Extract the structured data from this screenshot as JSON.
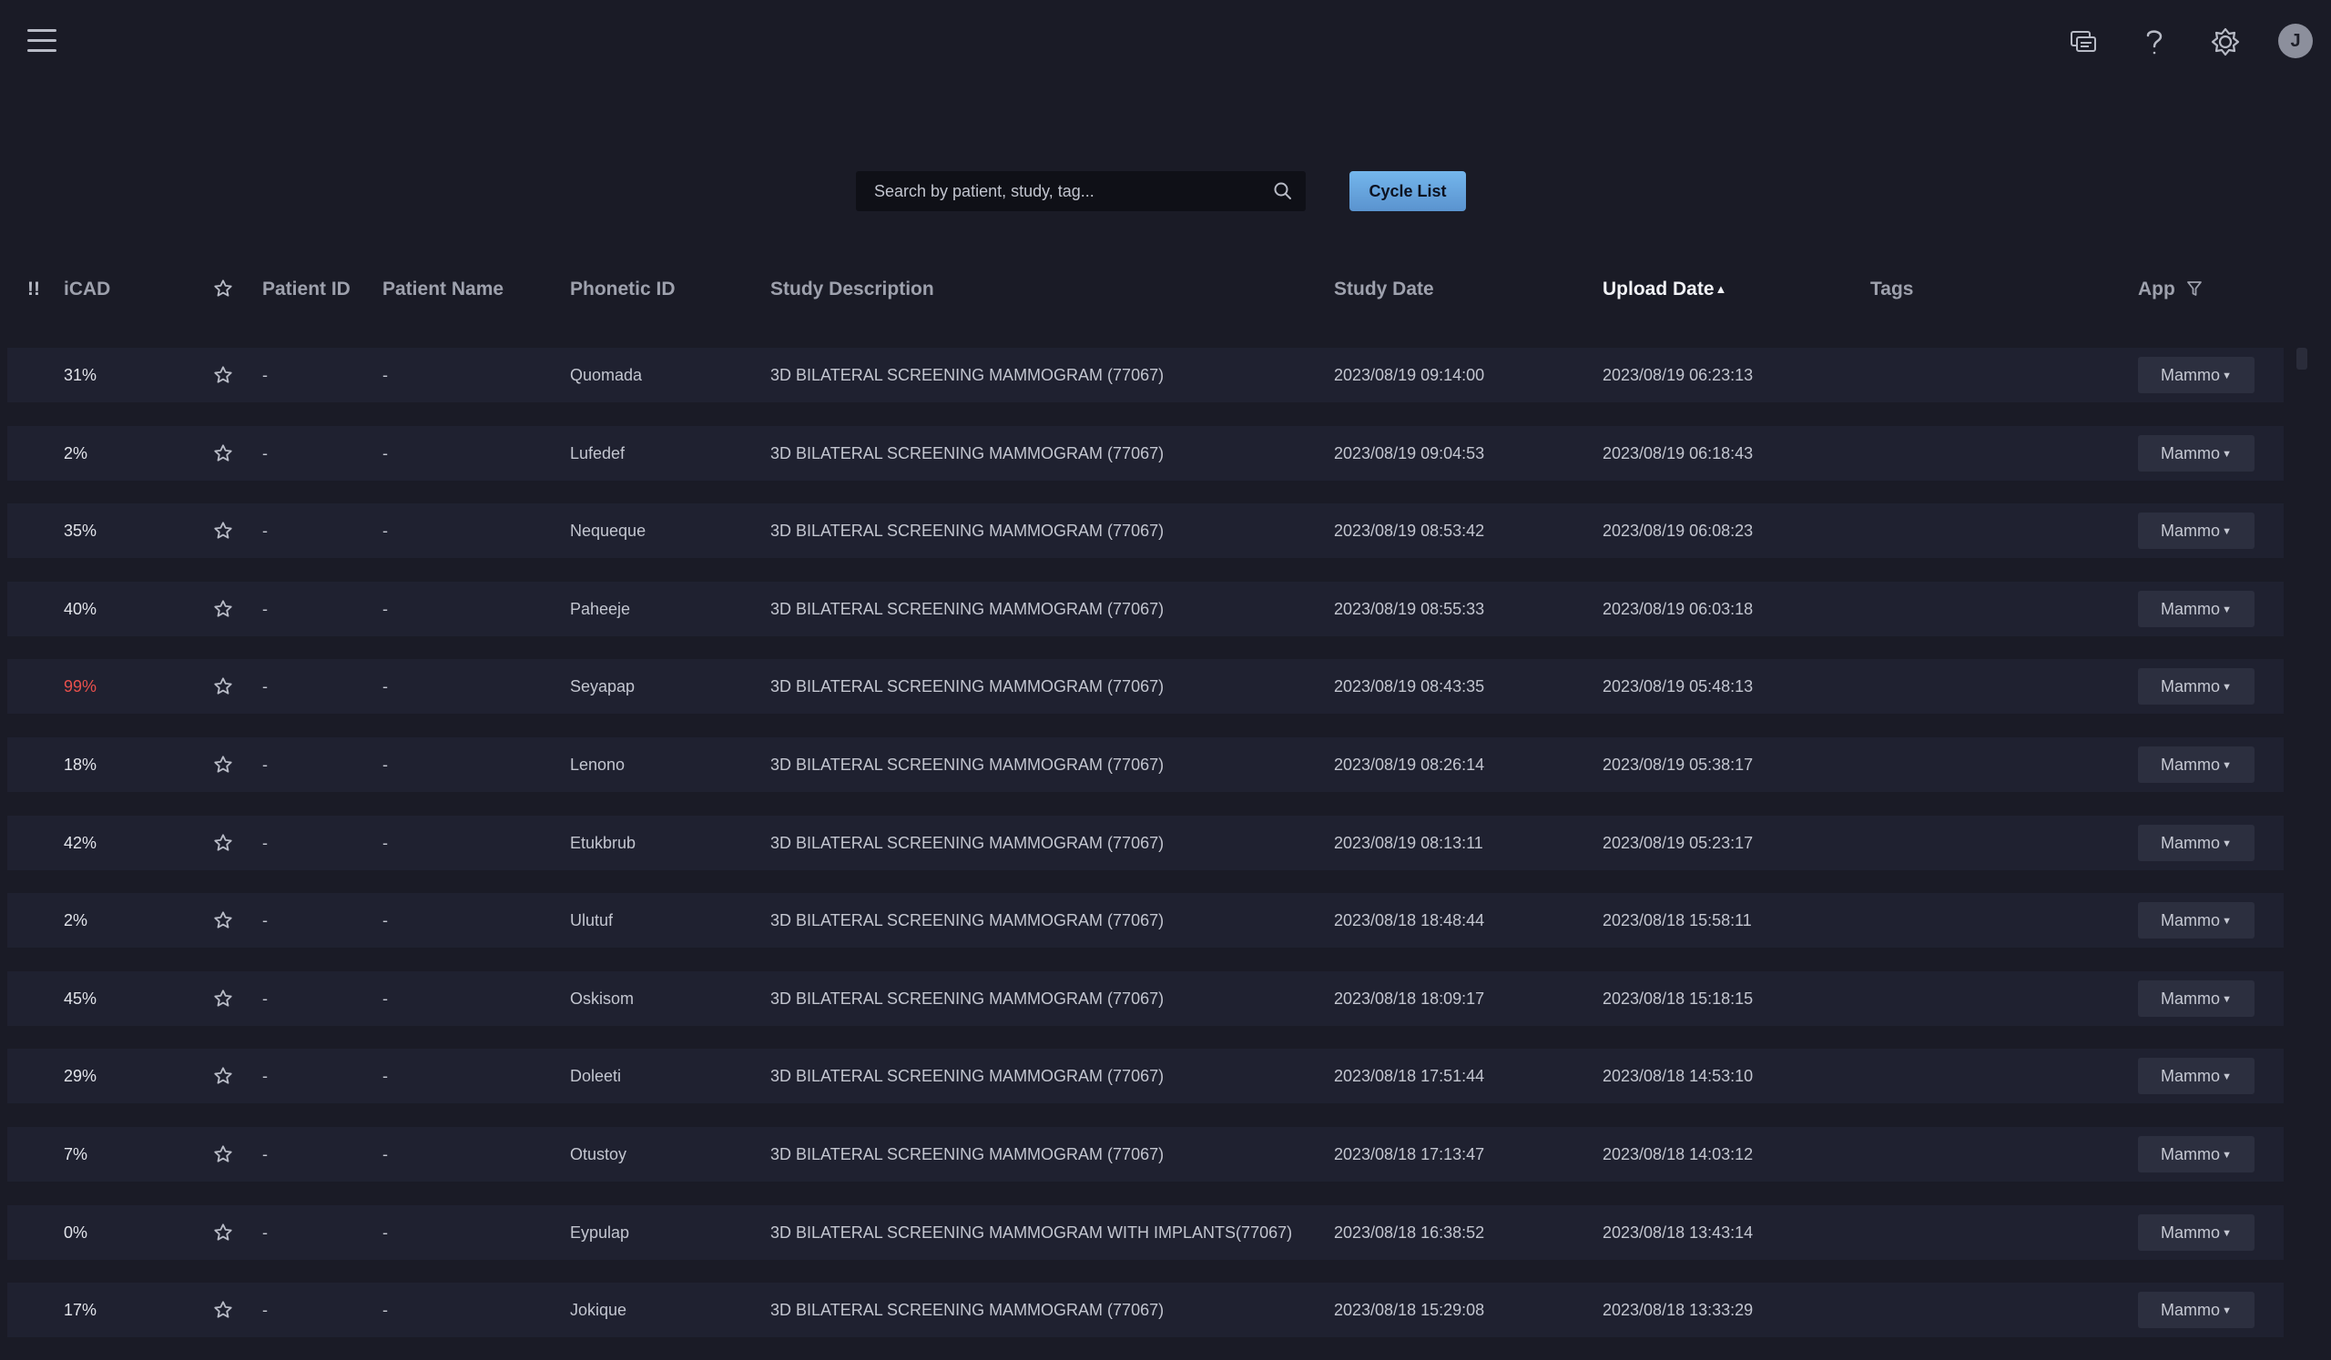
{
  "topbar": {
    "menu_icon": "hamburger-menu-icon",
    "icons": [
      "chat-icon",
      "help-icon",
      "settings-icon"
    ],
    "avatar_initial": "J"
  },
  "search": {
    "placeholder": "Search by patient, study, tag...",
    "icon": "search-icon"
  },
  "cycle_button_label": "Cycle List",
  "table": {
    "headers": {
      "priority": "!!",
      "icad": "iCAD",
      "patient_id": "Patient ID",
      "patient_name": "Patient Name",
      "phonetic_id": "Phonetic ID",
      "study_description": "Study Description",
      "study_date": "Study Date",
      "upload_date": "Upload Date",
      "tags": "Tags",
      "app": "App"
    },
    "sorted_by": "upload_date",
    "sort_direction": "ascending",
    "rows": [
      {
        "icad": "31%",
        "patient_id": "-",
        "patient_name": "-",
        "phonetic_id": "Quomada",
        "study_description": "3D BILATERAL SCREENING MAMMOGRAM (77067)",
        "study_date": "2023/08/19 09:14:00",
        "upload_date": "2023/08/19 06:23:13",
        "tags": "",
        "app": "Mammo",
        "high_risk": false
      },
      {
        "icad": "2%",
        "patient_id": "-",
        "patient_name": "-",
        "phonetic_id": "Lufedef",
        "study_description": "3D BILATERAL SCREENING MAMMOGRAM (77067)",
        "study_date": "2023/08/19 09:04:53",
        "upload_date": "2023/08/19 06:18:43",
        "tags": "",
        "app": "Mammo",
        "high_risk": false
      },
      {
        "icad": "35%",
        "patient_id": "-",
        "patient_name": "-",
        "phonetic_id": "Nequeque",
        "study_description": "3D BILATERAL SCREENING MAMMOGRAM (77067)",
        "study_date": "2023/08/19 08:53:42",
        "upload_date": "2023/08/19 06:08:23",
        "tags": "",
        "app": "Mammo",
        "high_risk": false
      },
      {
        "icad": "40%",
        "patient_id": "-",
        "patient_name": "-",
        "phonetic_id": "Paheeje",
        "study_description": "3D BILATERAL SCREENING MAMMOGRAM (77067)",
        "study_date": "2023/08/19 08:55:33",
        "upload_date": "2023/08/19 06:03:18",
        "tags": "",
        "app": "Mammo",
        "high_risk": false
      },
      {
        "icad": "99%",
        "patient_id": "-",
        "patient_name": "-",
        "phonetic_id": "Seyapap",
        "study_description": "3D BILATERAL SCREENING MAMMOGRAM (77067)",
        "study_date": "2023/08/19 08:43:35",
        "upload_date": "2023/08/19 05:48:13",
        "tags": "",
        "app": "Mammo",
        "high_risk": true
      },
      {
        "icad": "18%",
        "patient_id": "-",
        "patient_name": "-",
        "phonetic_id": "Lenono",
        "study_description": "3D BILATERAL SCREENING MAMMOGRAM (77067)",
        "study_date": "2023/08/19 08:26:14",
        "upload_date": "2023/08/19 05:38:17",
        "tags": "",
        "app": "Mammo",
        "high_risk": false
      },
      {
        "icad": "42%",
        "patient_id": "-",
        "patient_name": "-",
        "phonetic_id": "Etukbrub",
        "study_description": "3D BILATERAL SCREENING MAMMOGRAM (77067)",
        "study_date": "2023/08/19 08:13:11",
        "upload_date": "2023/08/19 05:23:17",
        "tags": "",
        "app": "Mammo",
        "high_risk": false
      },
      {
        "icad": "2%",
        "patient_id": "-",
        "patient_name": "-",
        "phonetic_id": "Ulutuf",
        "study_description": "3D BILATERAL SCREENING MAMMOGRAM (77067)",
        "study_date": "2023/08/18 18:48:44",
        "upload_date": "2023/08/18 15:58:11",
        "tags": "",
        "app": "Mammo",
        "high_risk": false
      },
      {
        "icad": "45%",
        "patient_id": "-",
        "patient_name": "-",
        "phonetic_id": "Oskisom",
        "study_description": "3D BILATERAL SCREENING MAMMOGRAM (77067)",
        "study_date": "2023/08/18 18:09:17",
        "upload_date": "2023/08/18 15:18:15",
        "tags": "",
        "app": "Mammo",
        "high_risk": false
      },
      {
        "icad": "29%",
        "patient_id": "-",
        "patient_name": "-",
        "phonetic_id": "Doleeti",
        "study_description": "3D BILATERAL SCREENING MAMMOGRAM (77067)",
        "study_date": "2023/08/18 17:51:44",
        "upload_date": "2023/08/18 14:53:10",
        "tags": "",
        "app": "Mammo",
        "high_risk": false
      },
      {
        "icad": "7%",
        "patient_id": "-",
        "patient_name": "-",
        "phonetic_id": "Otustoy",
        "study_description": "3D BILATERAL SCREENING MAMMOGRAM (77067)",
        "study_date": "2023/08/18 17:13:47",
        "upload_date": "2023/08/18 14:03:12",
        "tags": "",
        "app": "Mammo",
        "high_risk": false
      },
      {
        "icad": "0%",
        "patient_id": "-",
        "patient_name": "-",
        "phonetic_id": "Eypulap",
        "study_description": "3D BILATERAL SCREENING MAMMOGRAM WITH IMPLANTS(77067)",
        "study_date": "2023/08/18 16:38:52",
        "upload_date": "2023/08/18 13:43:14",
        "tags": "",
        "app": "Mammo",
        "high_risk": false
      },
      {
        "icad": "17%",
        "patient_id": "-",
        "patient_name": "-",
        "phonetic_id": "Jokique",
        "study_description": "3D BILATERAL SCREENING MAMMOGRAM (77067)",
        "study_date": "2023/08/18 15:29:08",
        "upload_date": "2023/08/18 13:33:29",
        "tags": "",
        "app": "Mammo",
        "high_risk": false
      }
    ]
  },
  "colors": {
    "background": "#1a1b26",
    "row_background": "#1f2130",
    "high_risk_text": "#e8504c",
    "cycle_button": "#6aa8e2"
  }
}
